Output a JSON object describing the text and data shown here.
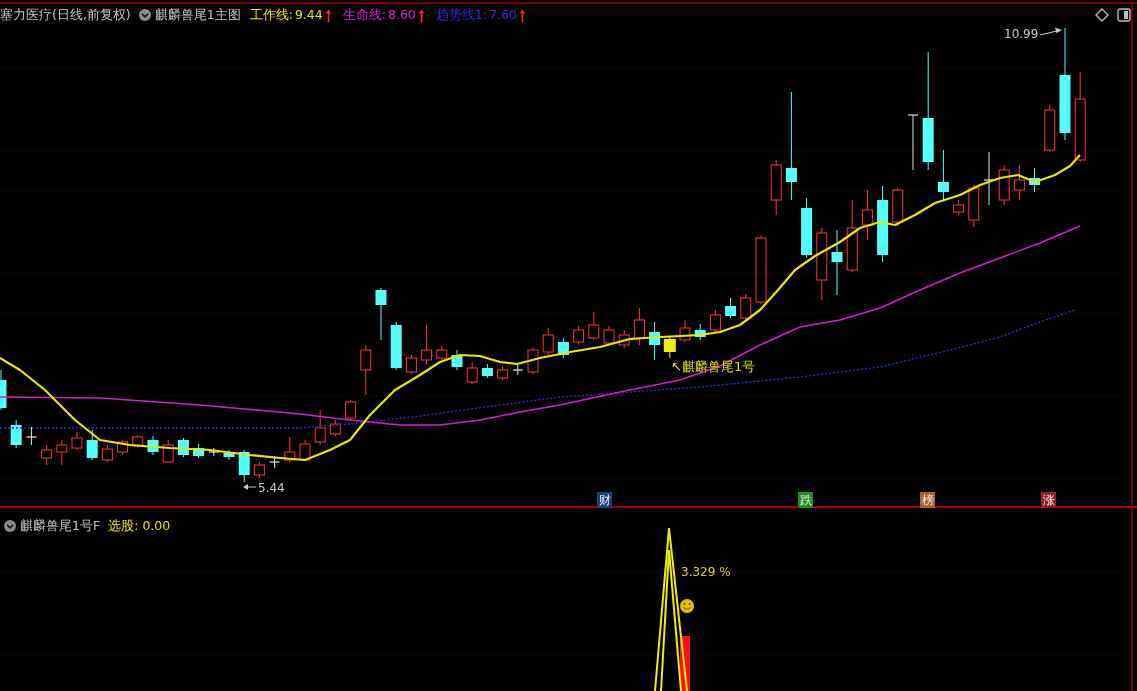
{
  "header": {
    "security": "塞力医疗(日线,前复权)",
    "template": "麒麟兽尾1主图",
    "indicators": [
      {
        "label": "工作线:",
        "value": "9.44",
        "color": "#e8e800",
        "rising": true
      },
      {
        "label": "生命线:",
        "value": "8.60",
        "color": "#d020d0",
        "rising": true
      },
      {
        "label": "趋势线1:",
        "value": "7.60",
        "color": "#2a2ae6",
        "rising": true
      }
    ]
  },
  "main_chart": {
    "high_label": "10.99",
    "low_label": "5.44",
    "signal_label": "↖麒麟兽尾1号",
    "events": [
      {
        "label": "财",
        "color": "#1c3f80"
      },
      {
        "label": "跌",
        "color": "#1d8f1d"
      },
      {
        "label": "榜",
        "color": "#a8652c"
      },
      {
        "label": "涨",
        "color": "#9a1b2c"
      }
    ]
  },
  "sub_chart": {
    "title": "麒麟兽尾1号F",
    "reading_label": "选股:",
    "reading_value": "0.00",
    "peak_label": "3.329 %"
  }
}
